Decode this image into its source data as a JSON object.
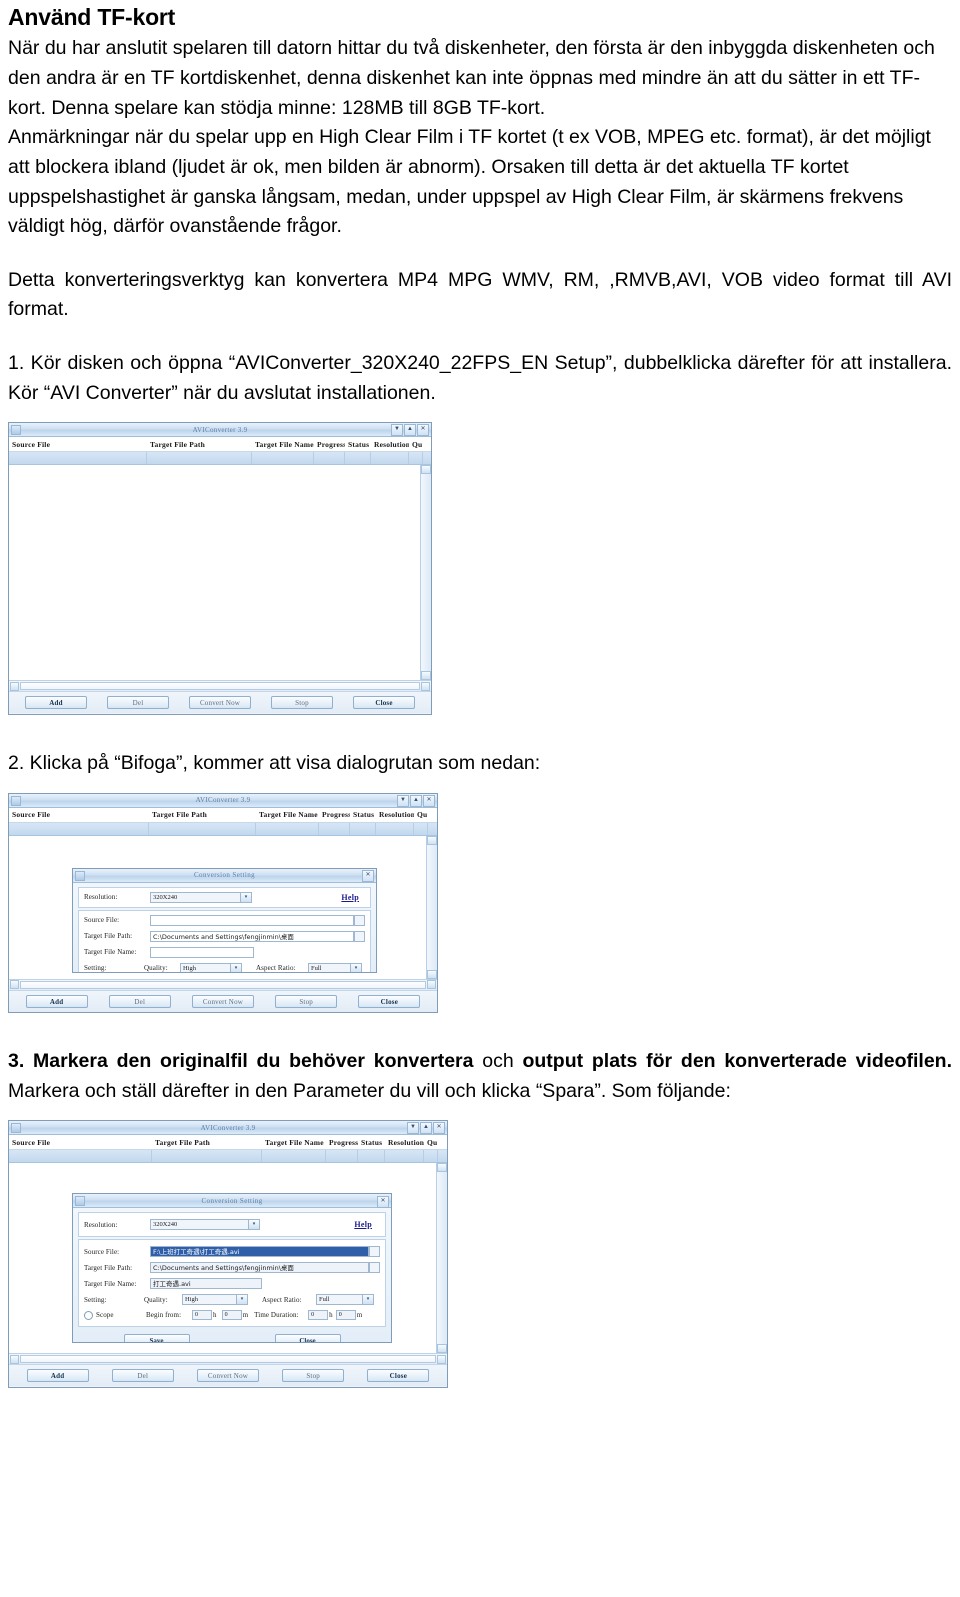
{
  "document": {
    "title": "Använd TF-kort",
    "paragraph1": "När du har anslutit spelaren till datorn hittar du två diskenheter, den första är den inbyggda diskenheten och den andra är en TF kortdiskenhet, denna diskenhet kan inte öppnas med mindre än att du sätter in ett TF-kort. Denna spelare kan stödja minne: 128MB till 8GB TF-kort.",
    "paragraph2": "Anmärkningar    när du spelar upp en   High Clear Film i TF kortet (t ex VOB, MPEG etc. format), är det möjligt att blockera ibland (ljudet är ok, men bilden är abnorm). Orsaken till detta är det aktuella TF kortet uppspelshastighet är ganska långsam, medan, under uppspel av High Clear Film, är skärmens frekvens väldigt hög, därför ovanstående frågor.",
    "paragraph3": "Detta konverteringsverktyg kan konvertera MP4  MPG  WMV, RM, ,RMVB,AVI, VOB video format till AVI format.",
    "step1": "1. Kör disken och öppna “AVIConverter_320X240_22FPS_EN Setup”, dubbelklicka därefter för att installera. Kör “AVI Converter” när du avslutat installationen.",
    "step2": "2. Klicka på “Bifoga”, kommer att visa dialogrutan som nedan:",
    "step3_bold_a": "3. Markera den originalfil du behöver konvertera",
    "step3_plain_a": " och ",
    "step3_bold_b": "output plats för den konverterade videofilen.",
    "step3_plain_b": " Markera och ställ därefter in den Parameter du vill och klicka “Spara”. Som följande:"
  },
  "app": {
    "window_title": "AVIConverter 3.9",
    "columns": [
      "Source File",
      "Target File Path",
      "Target File Name",
      "Progress",
      "Status",
      "Resolution",
      "Qu"
    ],
    "buttons": {
      "add": "Add",
      "del": "Del",
      "convert_now": "Convert Now",
      "stop": "Stop",
      "close": "Close"
    },
    "scroll": {
      "up_arrow": "▲",
      "down_arrow": "▼",
      "left_arrow": "◄",
      "right_arrow": "►"
    },
    "titlebar_buttons": {
      "minimize": "▼",
      "maximize": "▲",
      "close": "✕"
    }
  },
  "dialog": {
    "title": "Conversion Setting",
    "close_glyph": "✕",
    "labels": {
      "resolution": "Resolution:",
      "help": "Help",
      "source_file": "Source File:",
      "target_file_path": "Target File Path:",
      "target_file_name": "Target File Name:",
      "setting": "Setting:",
      "quality": "Quality:",
      "aspect_ratio": "Aspect Ratio:",
      "scope": "Scope",
      "begin_from": "Begin from:",
      "time_duration": "Time Duration:",
      "hour": "h",
      "minute": "m"
    },
    "empty_values": {
      "resolution": "320X240",
      "source_file": "",
      "target_file_path": "C:\\Documents and Settings\\fengjinmin\\桌面",
      "target_file_name": "",
      "quality": "High",
      "aspect_ratio": "Full",
      "begin_h": "0",
      "begin_m": "0",
      "dur_h": "0",
      "dur_m": "0"
    },
    "filled_values": {
      "resolution": "320X240",
      "source_file": "F:\\上班打工奇遇\\打工奇遇.avi",
      "target_file_path": "C:\\Documents and Settings\\fengjinmin\\桌面",
      "target_file_name": "打工奇遇.avi",
      "quality": "High",
      "aspect_ratio": "Full",
      "begin_h": "0",
      "begin_m": "0",
      "dur_h": "0",
      "dur_m": "0"
    },
    "buttons": {
      "save": "Save",
      "close": "Close"
    },
    "dropdown_glyph": "▾"
  },
  "colors": {
    "chrome_blue": "#bcd4ec",
    "title_text": "#5c7fa5",
    "link": "#1a1a8c",
    "selection": "#2f5fa8"
  }
}
